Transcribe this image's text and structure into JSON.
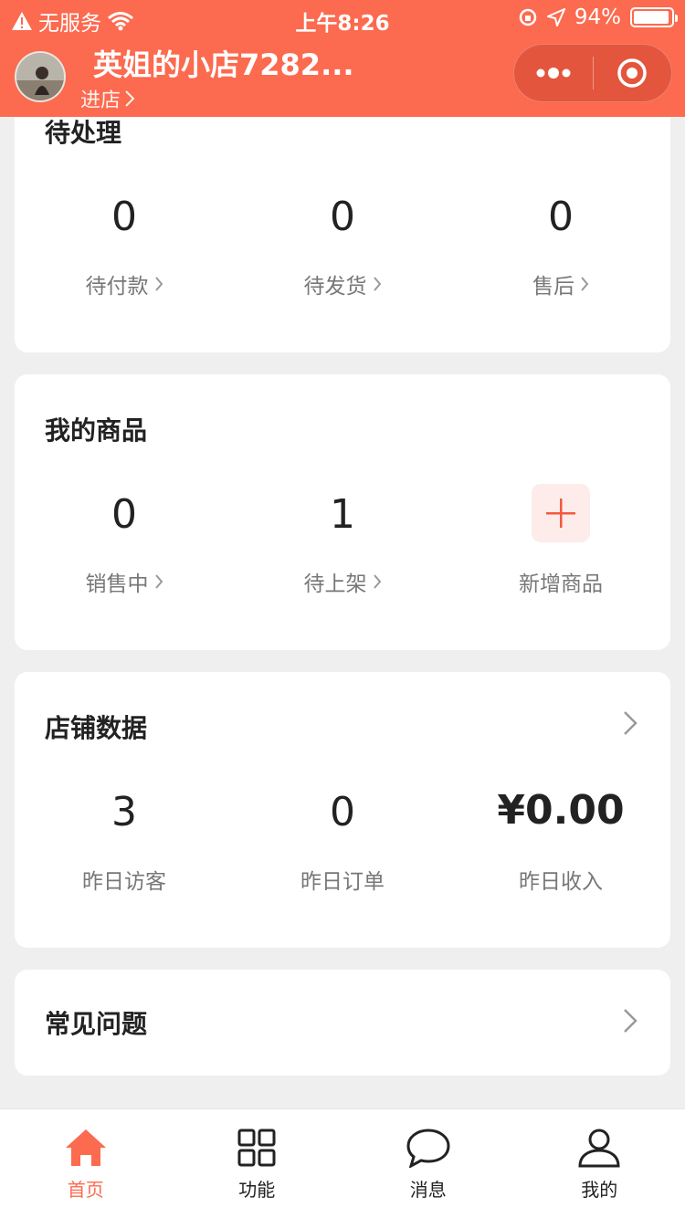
{
  "status_bar": {
    "carrier": "无服务",
    "time": "上午8:26",
    "battery": "94%",
    "battery_level": 0.94
  },
  "header": {
    "shop_name": "英姐的小店7282...",
    "enter_shop": "进店"
  },
  "pending": {
    "title": "待处理",
    "items": [
      {
        "value": "0",
        "label": "待付款"
      },
      {
        "value": "0",
        "label": "待发货"
      },
      {
        "value": "0",
        "label": "售后"
      }
    ]
  },
  "products": {
    "title": "我的商品",
    "items": [
      {
        "value": "0",
        "label": "销售中"
      },
      {
        "value": "1",
        "label": "待上架"
      }
    ],
    "add_label": "新增商品"
  },
  "store_data": {
    "title": "店铺数据",
    "items": [
      {
        "value": "3",
        "label": "昨日访客"
      },
      {
        "value": "0",
        "label": "昨日订单"
      },
      {
        "value": "¥0.00",
        "label": "昨日收入"
      }
    ]
  },
  "faq": {
    "title": "常见问题"
  },
  "tabs": [
    {
      "label": "首页",
      "icon": "home-icon",
      "active": true
    },
    {
      "label": "功能",
      "icon": "grid-icon",
      "active": false
    },
    {
      "label": "消息",
      "icon": "chat-bubble-icon",
      "active": false
    },
    {
      "label": "我的",
      "icon": "user-icon",
      "active": false
    }
  ],
  "colors": {
    "brand": "#fc6a4f",
    "plus_bg": "#fdecea"
  }
}
